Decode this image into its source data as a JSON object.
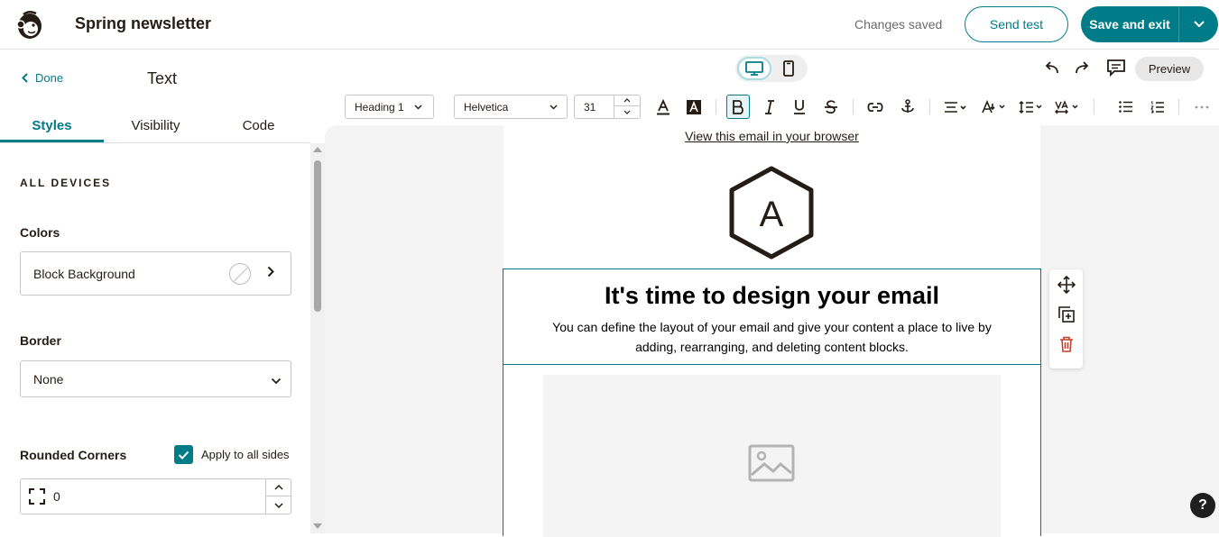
{
  "header": {
    "title": "Spring newsletter",
    "status": "Changes saved",
    "send_test_label": "Send test",
    "save_exit_label": "Save and exit"
  },
  "sidebar": {
    "done_label": "Done",
    "title": "Text",
    "tabs": [
      {
        "label": "Styles",
        "active": true
      },
      {
        "label": "Visibility",
        "active": false
      },
      {
        "label": "Code",
        "active": false
      }
    ],
    "section_label": "ALL DEVICES",
    "colors_label": "Colors",
    "block_background_label": "Block Background",
    "border_label": "Border",
    "border_value": "None",
    "rounded_corners_label": "Rounded Corners",
    "apply_all_sides_label": "Apply to all sides",
    "apply_all_sides_checked": true,
    "corner_value": "0"
  },
  "editor": {
    "preview_label": "Preview",
    "toolbar": {
      "block_style": "Heading 1",
      "font_family": "Helvetica",
      "font_size": "31"
    },
    "email": {
      "view_in_browser": "View this email in your browser",
      "logo_letter": "A",
      "heading": "It's time to design your email",
      "body": "You can define the layout of your email and give your content a place to live by adding, rearranging, and deleting content blocks."
    },
    "help_label": "?"
  },
  "colors": {
    "accent": "#007c89",
    "delete": "#c0412a"
  }
}
